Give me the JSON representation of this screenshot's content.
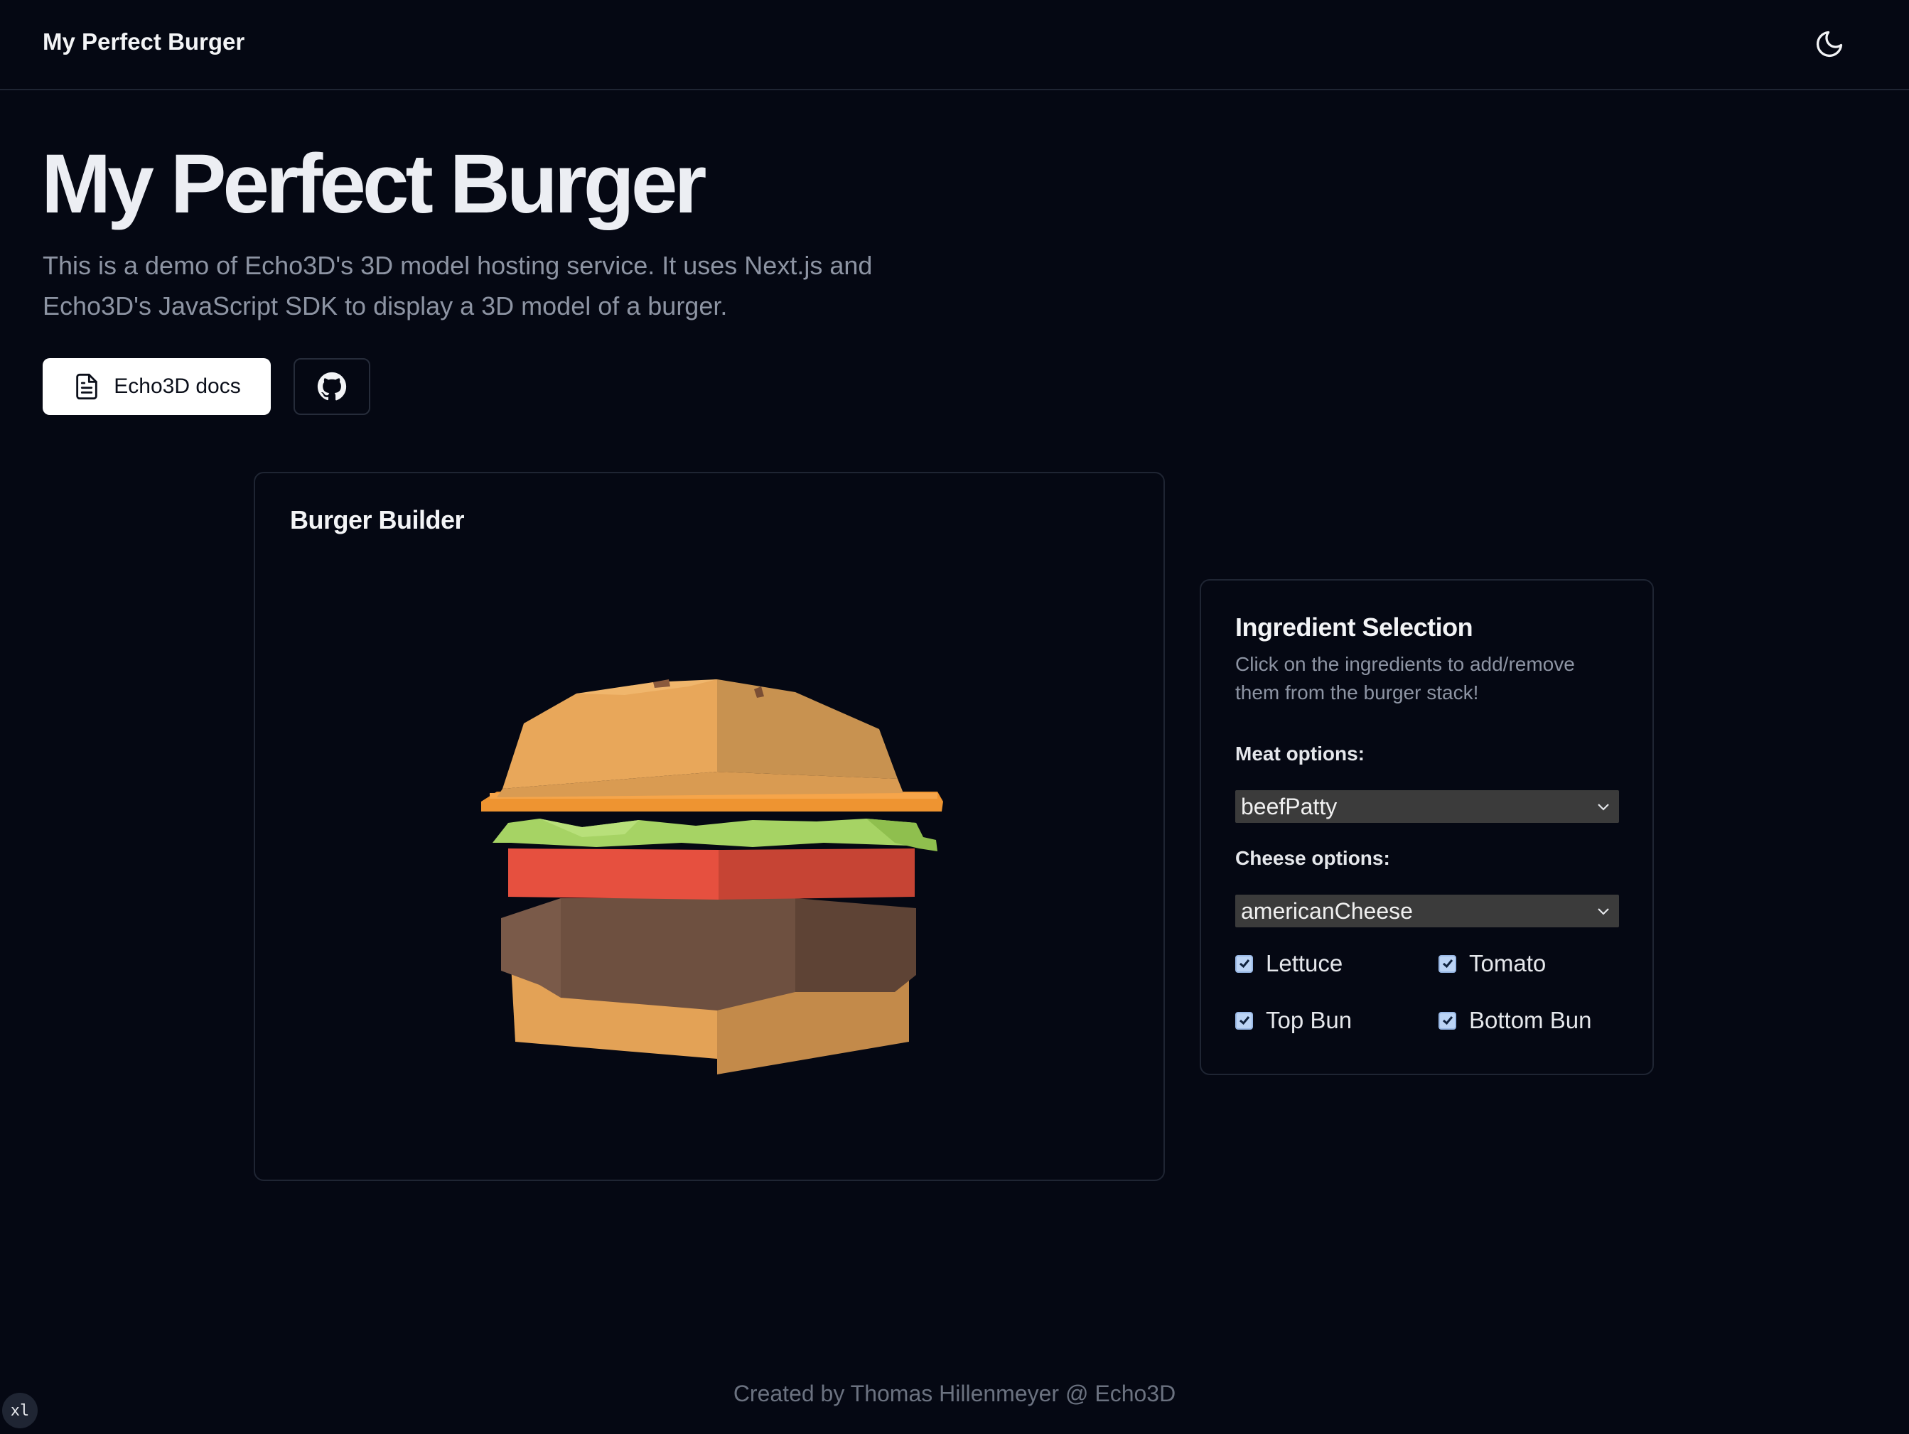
{
  "header": {
    "brand": "My Perfect Burger",
    "theme_icon": "moon-icon"
  },
  "hero": {
    "title": "My Perfect Burger",
    "description": "This is a demo of Echo3D's 3D model hosting service. It uses Next.js and Echo3D's JavaScript SDK to display a 3D model of a burger.",
    "docs_button": {
      "label": "Echo3D docs",
      "icon": "document-icon"
    },
    "github_button": {
      "icon": "github-icon"
    }
  },
  "builder": {
    "title": "Burger Builder",
    "layers": [
      "Top Bun",
      "americanCheese",
      "Lettuce",
      "Tomato",
      "beefPatty",
      "Bottom Bun"
    ]
  },
  "ingredients": {
    "title": "Ingredient Selection",
    "description": "Click on the ingredients to add/remove them from the burger stack!",
    "meat_label": "Meat options:",
    "meat_value": "beefPatty",
    "cheese_label": "Cheese options:",
    "cheese_value": "americanCheese",
    "toggles": [
      {
        "label": "Lettuce",
        "checked": true
      },
      {
        "label": "Tomato",
        "checked": true
      },
      {
        "label": "Top Bun",
        "checked": true
      },
      {
        "label": "Bottom Bun",
        "checked": true
      }
    ]
  },
  "footer": {
    "text": "Created by Thomas Hillenmeyer @ Echo3D"
  },
  "breakpoint_badge": "xl",
  "colors": {
    "background": "#050813",
    "border": "#1f2533",
    "muted_text": "#8d94a3",
    "bun": "#e3a256",
    "cheese": "#ee9431",
    "lettuce": "#9ccc5a",
    "tomato": "#e6503f",
    "patty": "#6e4f40"
  }
}
